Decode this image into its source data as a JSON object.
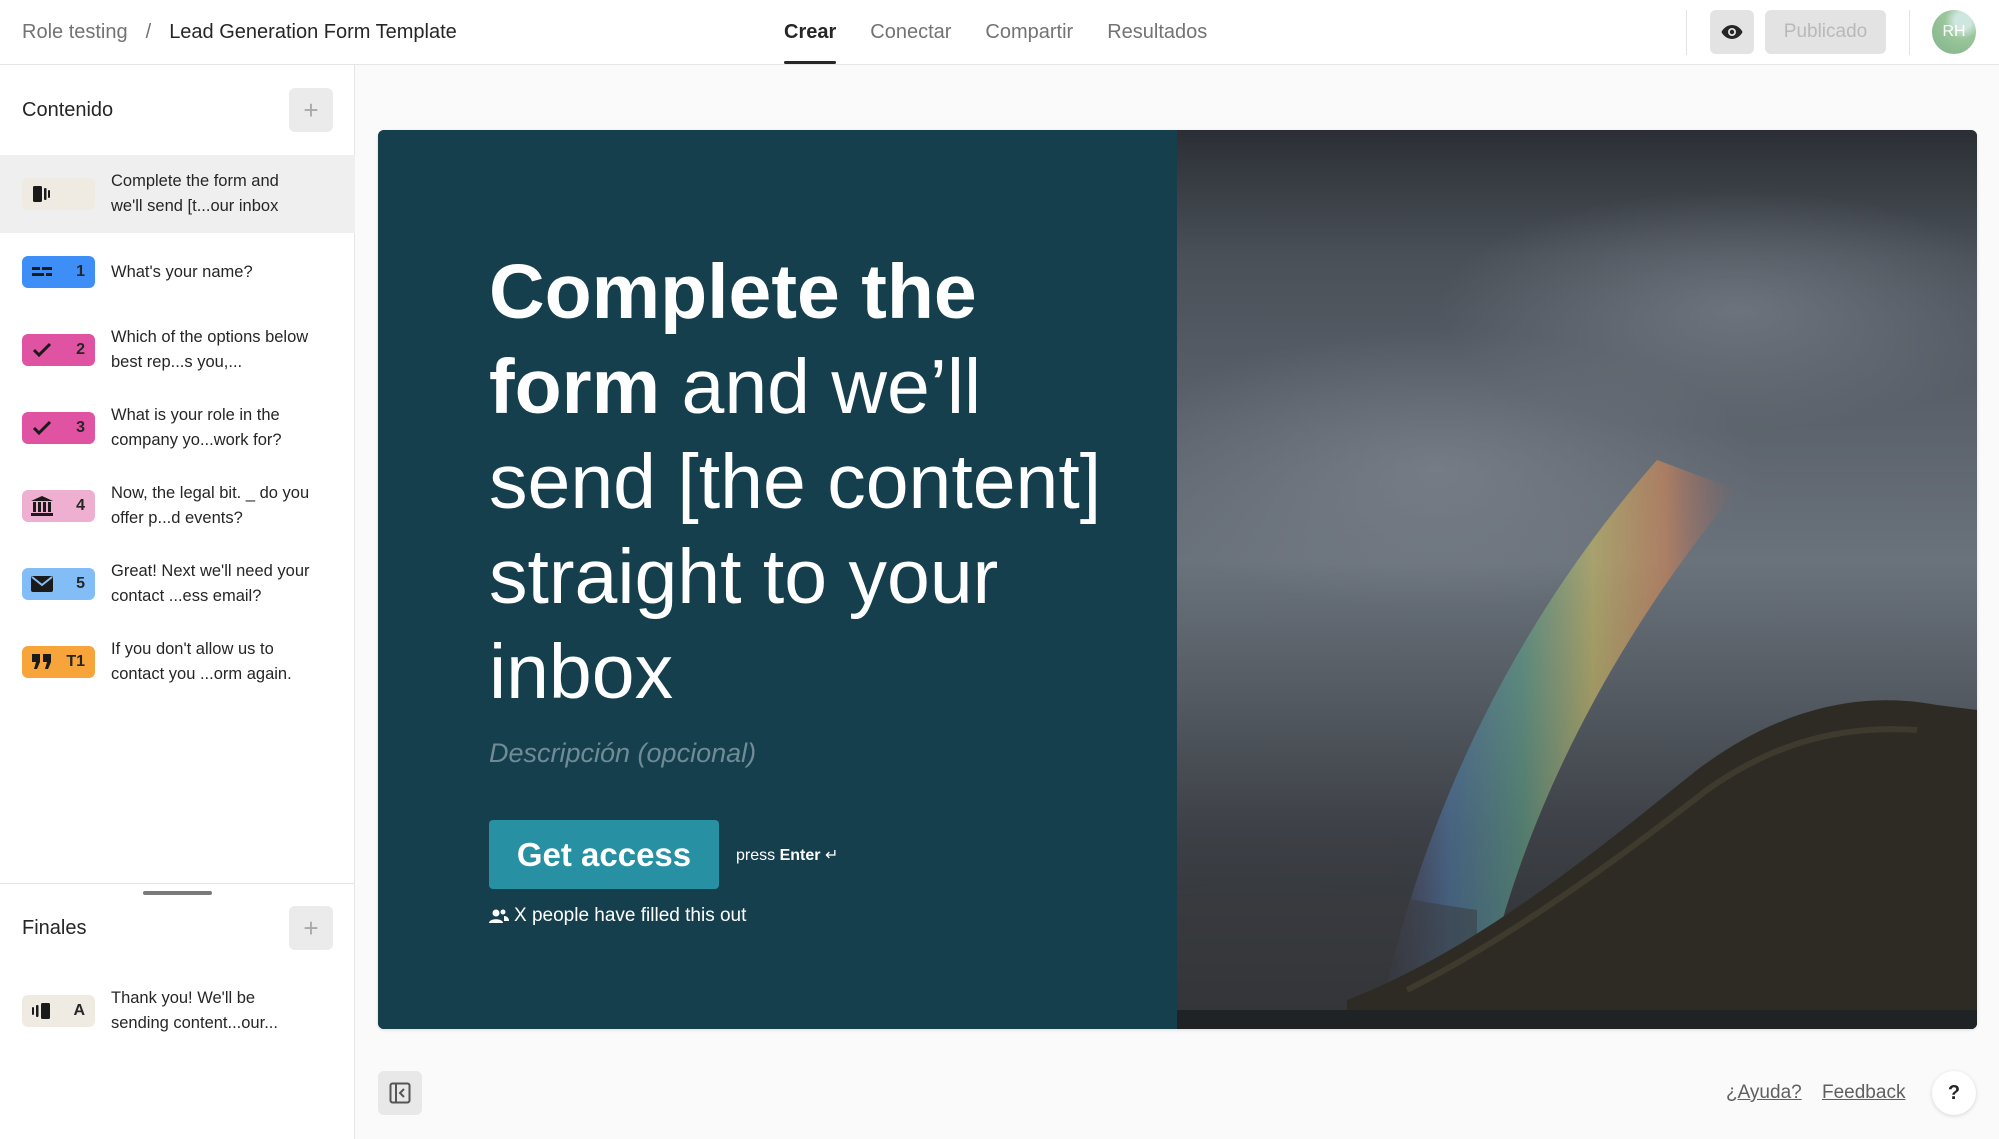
{
  "breadcrumb": {
    "workspace": "Role testing",
    "separator": "/",
    "form_name": "Lead Generation Form Template"
  },
  "nav": {
    "tabs": [
      {
        "label": "Crear",
        "active": true
      },
      {
        "label": "Conectar",
        "active": false
      },
      {
        "label": "Compartir",
        "active": false
      },
      {
        "label": "Resultados",
        "active": false
      }
    ]
  },
  "toolbar": {
    "preview_icon": "eye-icon",
    "publish_label": "Publicado",
    "avatar_initials": "RH"
  },
  "sidebar": {
    "content_title": "Contenido",
    "add_label": "+",
    "items": [
      {
        "badge": "",
        "icon": "welcome-screen-icon",
        "color": "#efeae2",
        "text": "Complete the form and we'll send [t...our inbox",
        "selected": true
      },
      {
        "badge": "1",
        "icon": "short-text-icon",
        "color": "#3e8ef7",
        "text": "What's your name?"
      },
      {
        "badge": "2",
        "icon": "checkmark-icon",
        "color": "#e052a2",
        "text": "Which of the options below best rep...s you,..."
      },
      {
        "badge": "3",
        "icon": "checkmark-icon",
        "color": "#e052a2",
        "text": "What is your role in the company yo...work for?"
      },
      {
        "badge": "4",
        "icon": "legal-icon",
        "color": "#efafd1",
        "text": "Now, the legal bit. _ do you offer p...d events?"
      },
      {
        "badge": "5",
        "icon": "envelope-icon",
        "color": "#83bdf7",
        "text": "Great! Next we'll need your contact ...ess email?"
      },
      {
        "badge": "T1",
        "icon": "quote-icon",
        "color": "#f7a53b",
        "text": "If you don't allow us to contact you ...orm again."
      }
    ],
    "endings_title": "Finales",
    "endings": [
      {
        "badge": "A",
        "icon": "ending-screen-icon",
        "color": "#efeae2",
        "text": "Thank you! We'll be sending content...our..."
      }
    ]
  },
  "preview": {
    "heading_bold": "Complete the form",
    "heading_rest": " and we’ll send [the content] straight to your inbox",
    "description_placeholder": "Descripción (opcional)",
    "button_label": "Get access",
    "hint_prefix": "press",
    "hint_key": "Enter",
    "hint_symbol": "↵",
    "social_proof": "X people have filled this out",
    "colors": {
      "background": "#163f4e",
      "button": "#2890a3"
    }
  },
  "footer": {
    "help_label": "¿Ayuda?",
    "feedback_label": "Feedback",
    "help_button": "?"
  }
}
